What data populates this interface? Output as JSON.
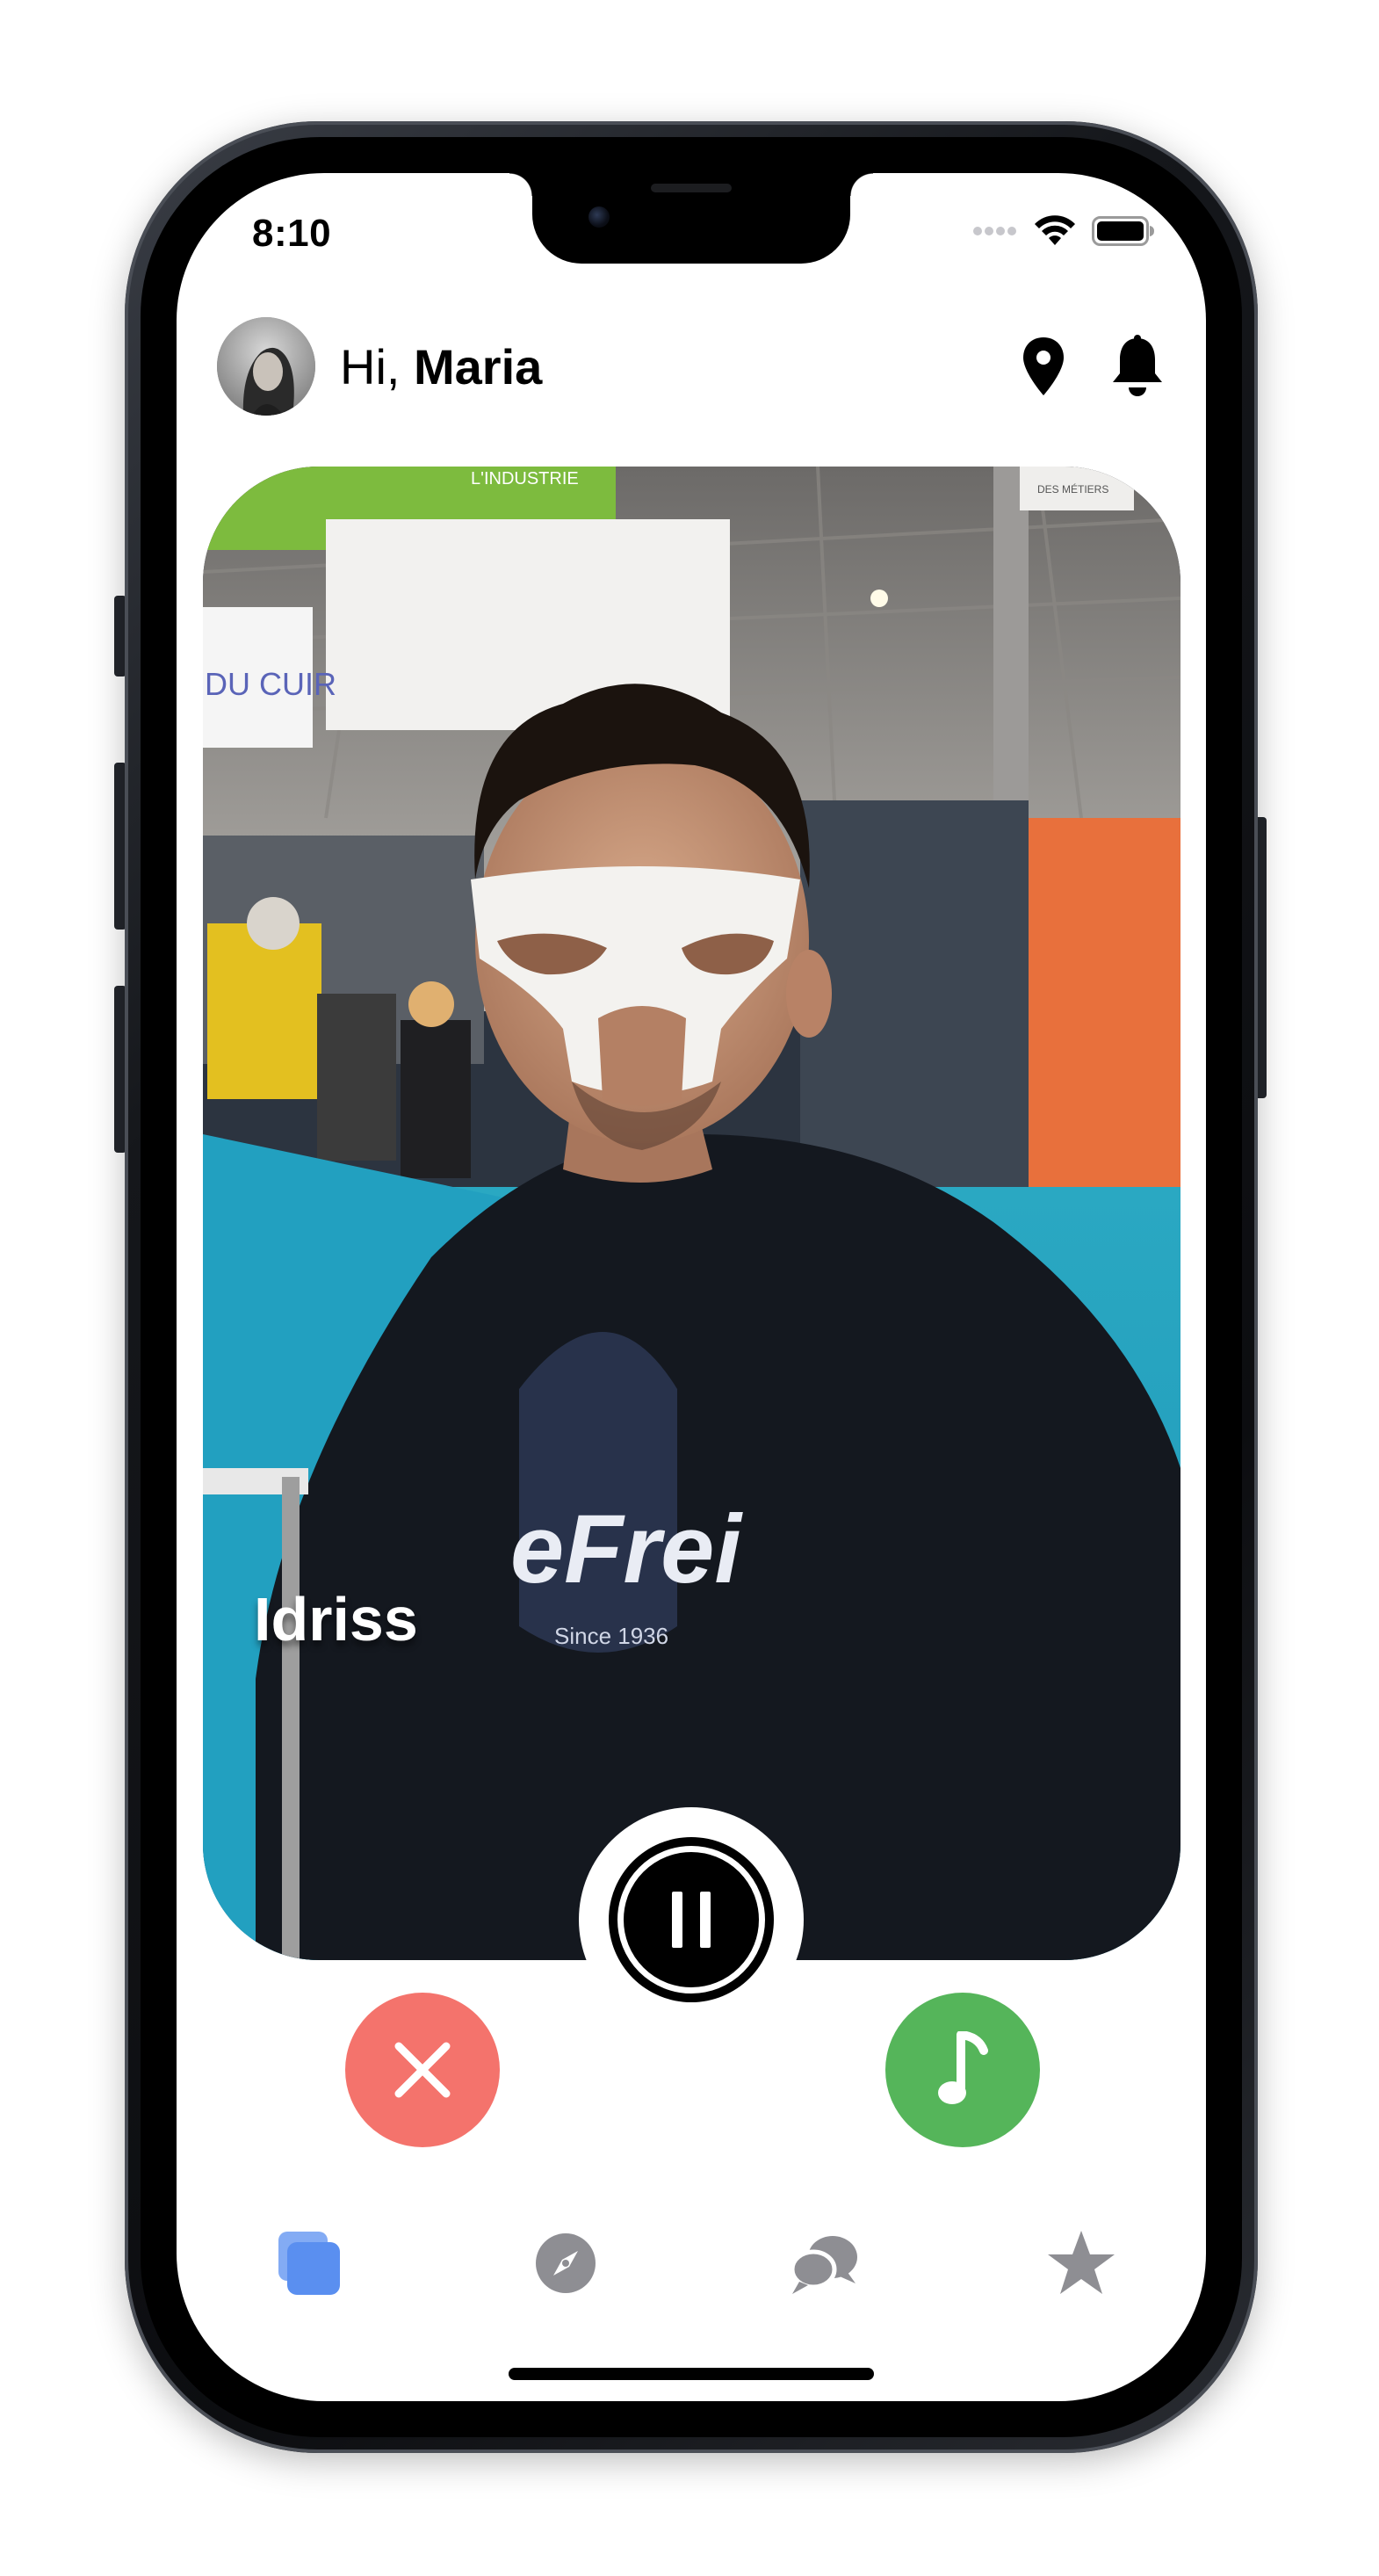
{
  "status_bar": {
    "time": "8:10"
  },
  "header": {
    "greeting_prefix": "Hi,",
    "user_name": "Maria"
  },
  "card": {
    "person_name": "Idriss",
    "background_sign_1": "L'INDUSTRIE",
    "background_sign_2": "DU CUIR",
    "background_sign_3": "DES MÉTIERS",
    "shirt_text_1": "eFrei",
    "shirt_text_2": "Since 1936"
  },
  "actions": {
    "dislike_icon": "close-icon",
    "like_icon": "music-note-icon",
    "playback_icon": "pause-icon"
  },
  "tab_bar": {
    "items": [
      {
        "name": "cards",
        "icon": "stack-cards-icon",
        "active": true
      },
      {
        "name": "discover",
        "icon": "compass-icon",
        "active": false
      },
      {
        "name": "messages",
        "icon": "chat-bubbles-icon",
        "active": false
      },
      {
        "name": "favorites",
        "icon": "star-icon",
        "active": false
      }
    ]
  },
  "colors": {
    "dislike": "#f4736c",
    "like": "#55b55a",
    "active_tab": "#5a8ff0",
    "inactive_tab": "#8e8e93"
  }
}
